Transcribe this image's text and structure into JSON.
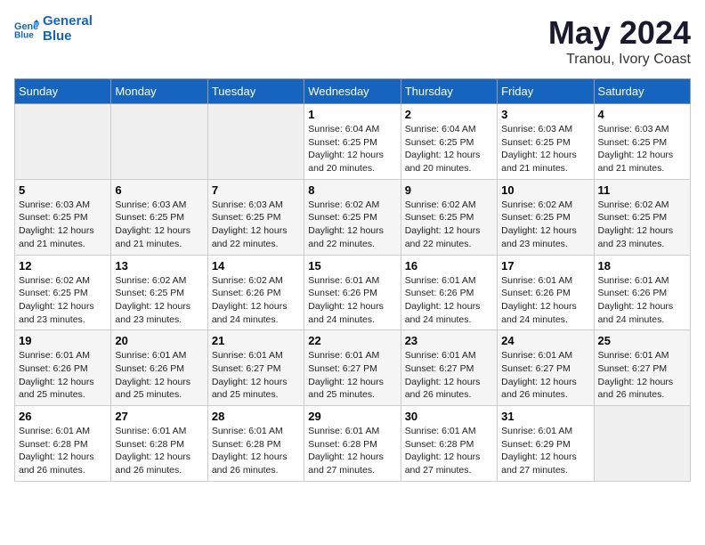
{
  "logo": {
    "line1": "General",
    "line2": "Blue"
  },
  "title": "May 2024",
  "subtitle": "Tranou, Ivory Coast",
  "header": {
    "days": [
      "Sunday",
      "Monday",
      "Tuesday",
      "Wednesday",
      "Thursday",
      "Friday",
      "Saturday"
    ]
  },
  "weeks": [
    [
      {
        "day": "",
        "info": ""
      },
      {
        "day": "",
        "info": ""
      },
      {
        "day": "",
        "info": ""
      },
      {
        "day": "1",
        "info": "Sunrise: 6:04 AM\nSunset: 6:25 PM\nDaylight: 12 hours\nand 20 minutes."
      },
      {
        "day": "2",
        "info": "Sunrise: 6:04 AM\nSunset: 6:25 PM\nDaylight: 12 hours\nand 20 minutes."
      },
      {
        "day": "3",
        "info": "Sunrise: 6:03 AM\nSunset: 6:25 PM\nDaylight: 12 hours\nand 21 minutes."
      },
      {
        "day": "4",
        "info": "Sunrise: 6:03 AM\nSunset: 6:25 PM\nDaylight: 12 hours\nand 21 minutes."
      }
    ],
    [
      {
        "day": "5",
        "info": "Sunrise: 6:03 AM\nSunset: 6:25 PM\nDaylight: 12 hours\nand 21 minutes."
      },
      {
        "day": "6",
        "info": "Sunrise: 6:03 AM\nSunset: 6:25 PM\nDaylight: 12 hours\nand 21 minutes."
      },
      {
        "day": "7",
        "info": "Sunrise: 6:03 AM\nSunset: 6:25 PM\nDaylight: 12 hours\nand 22 minutes."
      },
      {
        "day": "8",
        "info": "Sunrise: 6:02 AM\nSunset: 6:25 PM\nDaylight: 12 hours\nand 22 minutes."
      },
      {
        "day": "9",
        "info": "Sunrise: 6:02 AM\nSunset: 6:25 PM\nDaylight: 12 hours\nand 22 minutes."
      },
      {
        "day": "10",
        "info": "Sunrise: 6:02 AM\nSunset: 6:25 PM\nDaylight: 12 hours\nand 23 minutes."
      },
      {
        "day": "11",
        "info": "Sunrise: 6:02 AM\nSunset: 6:25 PM\nDaylight: 12 hours\nand 23 minutes."
      }
    ],
    [
      {
        "day": "12",
        "info": "Sunrise: 6:02 AM\nSunset: 6:25 PM\nDaylight: 12 hours\nand 23 minutes."
      },
      {
        "day": "13",
        "info": "Sunrise: 6:02 AM\nSunset: 6:25 PM\nDaylight: 12 hours\nand 23 minutes."
      },
      {
        "day": "14",
        "info": "Sunrise: 6:02 AM\nSunset: 6:26 PM\nDaylight: 12 hours\nand 24 minutes."
      },
      {
        "day": "15",
        "info": "Sunrise: 6:01 AM\nSunset: 6:26 PM\nDaylight: 12 hours\nand 24 minutes."
      },
      {
        "day": "16",
        "info": "Sunrise: 6:01 AM\nSunset: 6:26 PM\nDaylight: 12 hours\nand 24 minutes."
      },
      {
        "day": "17",
        "info": "Sunrise: 6:01 AM\nSunset: 6:26 PM\nDaylight: 12 hours\nand 24 minutes."
      },
      {
        "day": "18",
        "info": "Sunrise: 6:01 AM\nSunset: 6:26 PM\nDaylight: 12 hours\nand 24 minutes."
      }
    ],
    [
      {
        "day": "19",
        "info": "Sunrise: 6:01 AM\nSunset: 6:26 PM\nDaylight: 12 hours\nand 25 minutes."
      },
      {
        "day": "20",
        "info": "Sunrise: 6:01 AM\nSunset: 6:26 PM\nDaylight: 12 hours\nand 25 minutes."
      },
      {
        "day": "21",
        "info": "Sunrise: 6:01 AM\nSunset: 6:27 PM\nDaylight: 12 hours\nand 25 minutes."
      },
      {
        "day": "22",
        "info": "Sunrise: 6:01 AM\nSunset: 6:27 PM\nDaylight: 12 hours\nand 25 minutes."
      },
      {
        "day": "23",
        "info": "Sunrise: 6:01 AM\nSunset: 6:27 PM\nDaylight: 12 hours\nand 26 minutes."
      },
      {
        "day": "24",
        "info": "Sunrise: 6:01 AM\nSunset: 6:27 PM\nDaylight: 12 hours\nand 26 minutes."
      },
      {
        "day": "25",
        "info": "Sunrise: 6:01 AM\nSunset: 6:27 PM\nDaylight: 12 hours\nand 26 minutes."
      }
    ],
    [
      {
        "day": "26",
        "info": "Sunrise: 6:01 AM\nSunset: 6:28 PM\nDaylight: 12 hours\nand 26 minutes."
      },
      {
        "day": "27",
        "info": "Sunrise: 6:01 AM\nSunset: 6:28 PM\nDaylight: 12 hours\nand 26 minutes."
      },
      {
        "day": "28",
        "info": "Sunrise: 6:01 AM\nSunset: 6:28 PM\nDaylight: 12 hours\nand 26 minutes."
      },
      {
        "day": "29",
        "info": "Sunrise: 6:01 AM\nSunset: 6:28 PM\nDaylight: 12 hours\nand 27 minutes."
      },
      {
        "day": "30",
        "info": "Sunrise: 6:01 AM\nSunset: 6:28 PM\nDaylight: 12 hours\nand 27 minutes."
      },
      {
        "day": "31",
        "info": "Sunrise: 6:01 AM\nSunset: 6:29 PM\nDaylight: 12 hours\nand 27 minutes."
      },
      {
        "day": "",
        "info": ""
      }
    ]
  ]
}
